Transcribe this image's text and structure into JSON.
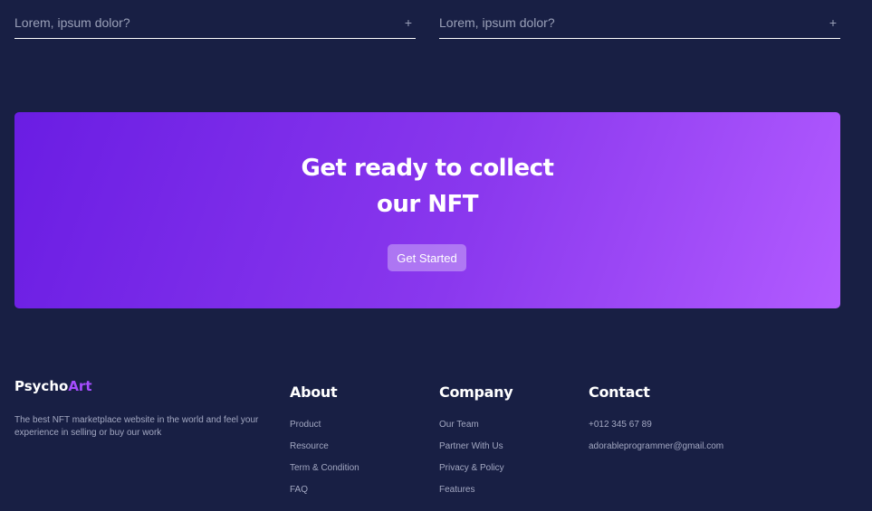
{
  "faq": {
    "items": [
      {
        "question": "Lorem, ipsum dolor?",
        "toggle": "+"
      },
      {
        "question": "Lorem, ipsum dolor?",
        "toggle": "+"
      }
    ]
  },
  "cta": {
    "title_line1": "Get ready to collect",
    "title_line2": "our NFT",
    "button_label": "Get Started",
    "gradient_start": "#6a1de3",
    "gradient_end": "#b25bff"
  },
  "footer": {
    "brand_part1": "Psycho",
    "brand_part2": "Art",
    "brand_accent": "#a64dff",
    "description": "The best NFT marketplace website in the world and feel your experience in selling or buy our work",
    "about": {
      "heading": "About",
      "links": [
        "Product",
        "Resource",
        "Term & Condition",
        "FAQ"
      ]
    },
    "company": {
      "heading": "Company",
      "links": [
        "Our Team",
        "Partner With Us",
        "Privacy & Policy",
        "Features"
      ]
    },
    "contact": {
      "heading": "Contact",
      "items": [
        "+012 345 67 89",
        "adorableprogrammer@gmail.com"
      ]
    }
  }
}
